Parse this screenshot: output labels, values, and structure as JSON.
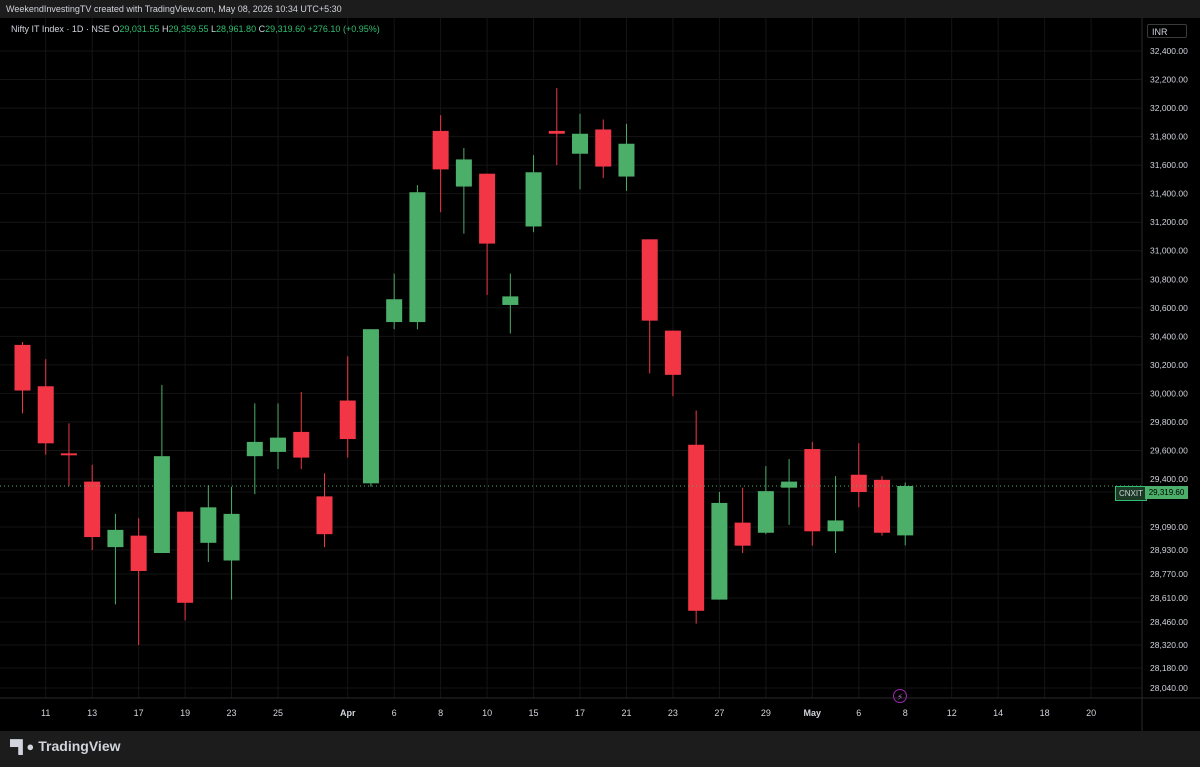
{
  "header": {
    "attribution": "WeekendInvestingTV created with TradingView.com, May 08, 2026 10:34 UTC+5:30"
  },
  "legend": {
    "symbol": "Nifty IT Index · 1D · NSE",
    "open_label": "O",
    "open": "29,031.55",
    "high_label": "H",
    "high": "29,359.55",
    "low_label": "L",
    "low": "28,961.80",
    "close_label": "C",
    "close": "29,319.60",
    "change": "+276.10 (+0.95%)"
  },
  "currency": "INR",
  "last_price": {
    "symbol": "CNXIT",
    "value": "29,319.60"
  },
  "footer": {
    "brand": "TradingView",
    "logo_icon": "tradingview-logo-icon"
  },
  "colors": {
    "up": "#4caf69",
    "down": "#f23645",
    "background": "#000000",
    "grid": "#151515",
    "axis_text": "#d1d4dc"
  },
  "chart_data": {
    "type": "candlestick",
    "title": "Nifty IT Index · 1D · NSE",
    "ylim": [
      27900,
      32500
    ],
    "y_ticks": [
      "32,400.00",
      "32,200.00",
      "32,000.00",
      "31,800.00",
      "31,600.00",
      "31,400.00",
      "31,200.00",
      "31,000.00",
      "30,800.00",
      "30,600.00",
      "30,400.00",
      "30,200.00",
      "30,000.00",
      "29,800.00",
      "29,600.00",
      "29,400.00",
      "29,250.00",
      "29,090.00",
      "28,930.00",
      "28,770.00",
      "28,610.00",
      "28,460.00",
      "28,320.00",
      "28,180.00",
      "28,040.00"
    ],
    "x_ticks": [
      "11",
      "13",
      "17",
      "19",
      "23",
      "25",
      "Apr",
      "6",
      "8",
      "10",
      "15",
      "17",
      "21",
      "23",
      "27",
      "29",
      "May",
      "6",
      "8",
      "12",
      "14",
      "18",
      "20"
    ],
    "x_tick_slots": [
      1,
      3,
      5,
      7,
      9,
      11,
      14,
      16,
      18,
      20,
      22,
      24,
      26,
      28,
      30,
      32,
      34,
      36,
      38,
      40,
      42,
      44,
      46
    ],
    "candles": [
      {
        "slot": 0,
        "o": 30340,
        "h": 30360,
        "l": 29860,
        "c": 30020
      },
      {
        "slot": 1,
        "o": 30050,
        "h": 30240,
        "l": 29570,
        "c": 29650
      },
      {
        "slot": 2,
        "o": 29580,
        "h": 29790,
        "l": 29320,
        "c": 29570
      },
      {
        "slot": 3,
        "o": 29370,
        "h": 29500,
        "l": 28930,
        "c": 29020
      },
      {
        "slot": 4,
        "o": 28950,
        "h": 29150,
        "l": 28570,
        "c": 29070
      },
      {
        "slot": 5,
        "o": 29030,
        "h": 29130,
        "l": 28320,
        "c": 28790
      },
      {
        "slot": 6,
        "o": 28910,
        "h": 30060,
        "l": 28910,
        "c": 29560
      },
      {
        "slot": 7,
        "o": 29160,
        "h": 29160,
        "l": 28470,
        "c": 28580
      },
      {
        "slot": 8,
        "o": 28980,
        "h": 29330,
        "l": 28850,
        "c": 29180
      },
      {
        "slot": 9,
        "o": 28860,
        "h": 29310,
        "l": 28600,
        "c": 29150
      },
      {
        "slot": 10,
        "o": 29560,
        "h": 29930,
        "l": 29240,
        "c": 29660
      },
      {
        "slot": 11,
        "o": 29590,
        "h": 29930,
        "l": 29470,
        "c": 29690
      },
      {
        "slot": 12,
        "o": 29730,
        "h": 30010,
        "l": 29470,
        "c": 29550
      },
      {
        "slot": 13,
        "o": 29230,
        "h": 29440,
        "l": 28950,
        "c": 29040
      },
      {
        "slot": 14,
        "o": 29950,
        "h": 30260,
        "l": 29550,
        "c": 29680
      },
      {
        "slot": 15,
        "o": 29350,
        "h": 30450,
        "l": 29310,
        "c": 30450
      },
      {
        "slot": 16,
        "o": 30500,
        "h": 30840,
        "l": 30450,
        "c": 30660
      },
      {
        "slot": 17,
        "o": 30500,
        "h": 31460,
        "l": 30450,
        "c": 31410
      },
      {
        "slot": 18,
        "o": 31840,
        "h": 31950,
        "l": 31270,
        "c": 31570
      },
      {
        "slot": 19,
        "o": 31450,
        "h": 31720,
        "l": 31120,
        "c": 31640
      },
      {
        "slot": 20,
        "o": 31540,
        "h": 31540,
        "l": 30690,
        "c": 31050
      },
      {
        "slot": 21,
        "o": 30620,
        "h": 30840,
        "l": 30420,
        "c": 30680
      },
      {
        "slot": 22,
        "o": 31170,
        "h": 31670,
        "l": 31130,
        "c": 31550
      },
      {
        "slot": 23,
        "o": 31840,
        "h": 32140,
        "l": 31600,
        "c": 31820
      },
      {
        "slot": 24,
        "o": 31680,
        "h": 31960,
        "l": 31430,
        "c": 31820
      },
      {
        "slot": 25,
        "o": 31850,
        "h": 31920,
        "l": 31510,
        "c": 31590
      },
      {
        "slot": 26,
        "o": 31520,
        "h": 31890,
        "l": 31420,
        "c": 31750
      },
      {
        "slot": 27,
        "o": 31080,
        "h": 31080,
        "l": 30140,
        "c": 30510
      },
      {
        "slot": 28,
        "o": 30440,
        "h": 30440,
        "l": 29980,
        "c": 30130
      },
      {
        "slot": 29,
        "o": 29640,
        "h": 29880,
        "l": 28450,
        "c": 28530
      },
      {
        "slot": 30,
        "o": 28600,
        "h": 29250,
        "l": 28600,
        "c": 29200
      },
      {
        "slot": 31,
        "o": 29110,
        "h": 29300,
        "l": 28910,
        "c": 28960
      },
      {
        "slot": 32,
        "o": 29050,
        "h": 29490,
        "l": 29040,
        "c": 29260
      },
      {
        "slot": 33,
        "o": 29300,
        "h": 29540,
        "l": 29100,
        "c": 29370
      },
      {
        "slot": 34,
        "o": 29610,
        "h": 29660,
        "l": 28960,
        "c": 29060
      },
      {
        "slot": 35,
        "o": 29060,
        "h": 29420,
        "l": 28910,
        "c": 29120
      },
      {
        "slot": 36,
        "o": 29430,
        "h": 29650,
        "l": 29180,
        "c": 29250
      },
      {
        "slot": 37,
        "o": 29390,
        "h": 29420,
        "l": 29030,
        "c": 29050
      },
      {
        "slot": 38,
        "o": 29031.55,
        "h": 29359.55,
        "l": 28961.8,
        "c": 29319.6
      }
    ]
  }
}
